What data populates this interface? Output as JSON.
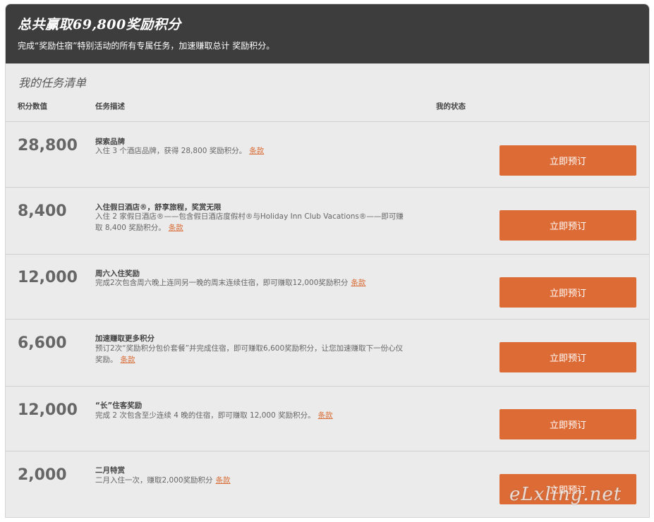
{
  "header": {
    "title": "总共赢取69,800奖励积分",
    "subtitle": "完成“奖励住宿”特别活动的所有专属任务，加速赚取总计 奖励积分。"
  },
  "list": {
    "title": "我的任务清单",
    "col_points": "积分数值",
    "col_desc": "任务描述",
    "col_status": "我的状态"
  },
  "missions": [
    {
      "points": "28,800",
      "name": "探索品牌",
      "desc": "入住 3 个酒店品牌，获得 28,800 奖励积分。",
      "terms": "条款",
      "button": "立即预订"
    },
    {
      "points": "8,400",
      "name": "入住假日酒店®，舒享旅程，奖赏无限",
      "desc": "入住 2 家假日酒店®——包含假日酒店度假村®与Holiday Inn Club Vacations®——即可赚取 8,400 奖励积分。",
      "terms": "条款",
      "button": "立即预订"
    },
    {
      "points": "12,000",
      "name": "周六入住奖励",
      "desc": "完成2次包含周六晚上连同另一晚的周末连续住宿，即可赚取12,000奖励积分",
      "terms": "条款",
      "button": "立即预订"
    },
    {
      "points": "6,600",
      "name": "加速赚取更多积分",
      "desc": "预订2次“奖励积分包价套餐”并完成住宿，即可赚取6,600奖励积分，让您加速赚取下一份心仪奖励。",
      "terms": "条款",
      "button": "立即预订"
    },
    {
      "points": "12,000",
      "name": "“长”住客奖励",
      "desc": "完成 2 次包含至少连续 4 晚的住宿，即可赚取 12,000 奖励积分。",
      "terms": "条款",
      "button": "立即预订"
    },
    {
      "points": "2,000",
      "name": "二月特赏",
      "desc": "二月入住一次，赚取2,000奖励积分",
      "terms": "条款",
      "button": "立即预订"
    }
  ],
  "watermark": "eLxling.net"
}
